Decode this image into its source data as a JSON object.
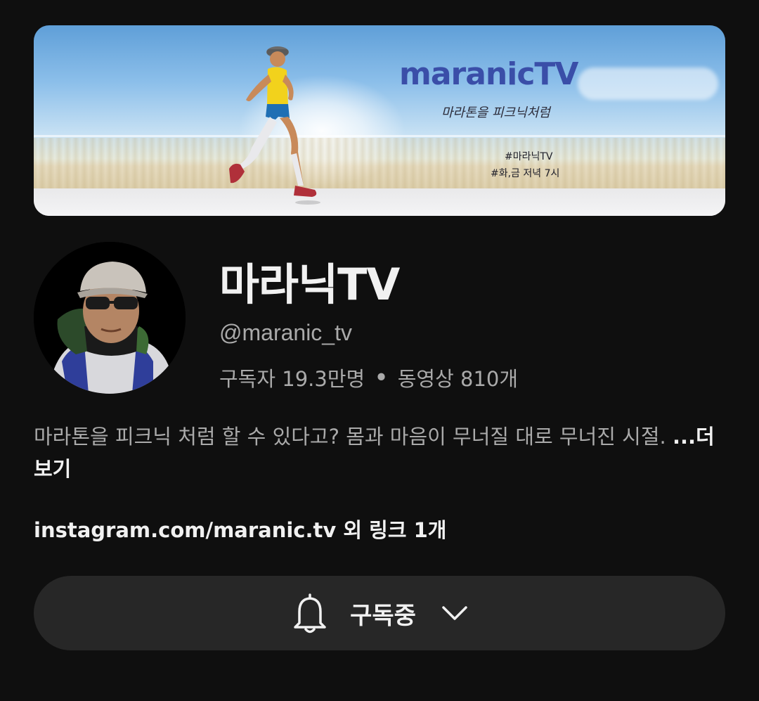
{
  "banner": {
    "brand": "maranicTV",
    "tagline": "마라톤을 피크닉처럼",
    "hashtag_1": "#마라닉TV",
    "hashtag_2": "#화,금 저녁 7시"
  },
  "channel": {
    "name": "마라닉TV",
    "handle": "@maranic_tv",
    "subscribers": "구독자 19.3만명",
    "separator": "•",
    "videos": "동영상 810개"
  },
  "description": {
    "text": "마라톤을 피크닉 처럼 할 수 있다고? 몸과 마음이 무너질 대로 무너진 시절. ",
    "more_label": "...더보기"
  },
  "links": {
    "label": "instagram.com/maranic.tv 외 링크 1개"
  },
  "subscribe": {
    "label": "구독중",
    "bell_icon": "bell-icon",
    "chevron_icon": "chevron-down-icon"
  },
  "colors": {
    "background": "#0f0f0f",
    "button_bg": "#272727",
    "text_primary": "#f1f1f1",
    "text_secondary": "#aaaaaa",
    "brand_blue": "#3a4ea8"
  }
}
